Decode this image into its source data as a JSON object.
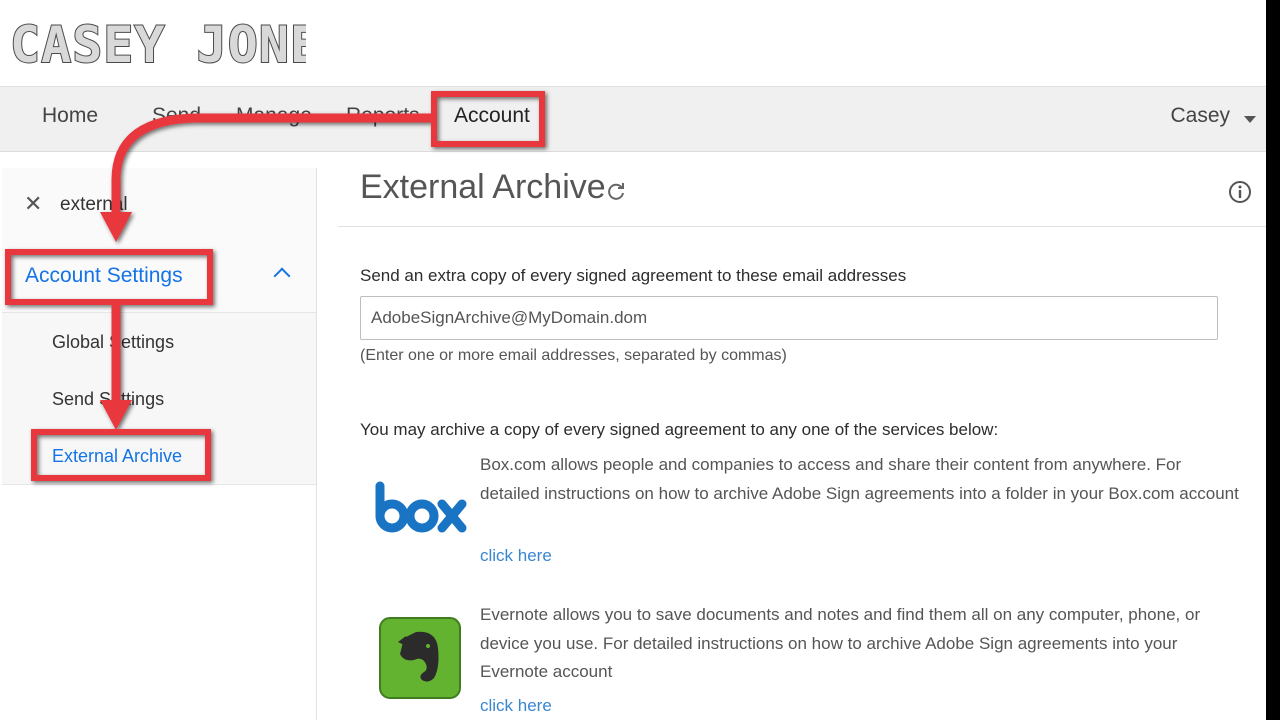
{
  "logo": {
    "text": "CASEY JONES"
  },
  "nav": {
    "items": [
      "Home",
      "Send",
      "Manage",
      "Reports",
      "Account"
    ],
    "user": "Casey"
  },
  "sidebar": {
    "search_value": "external",
    "section": "Account Settings",
    "items": [
      "Global Settings",
      "Send Settings",
      "External Archive"
    ]
  },
  "main": {
    "title": "External Archive",
    "email_label": "Send an extra copy of every signed agreement to these email addresses",
    "email_value": "AdobeSignArchive@MyDomain.dom",
    "email_help": "(Enter one or more email addresses, separated by commas)",
    "archive_label": "You may archive a copy of every signed agreement to any one of the services below:",
    "services": [
      {
        "name": "box",
        "description": "Box.com allows people and companies to access and share their content from anywhere. For detailed instructions on how to archive Adobe Sign agreements into a folder in your Box.com account",
        "link": "click here"
      },
      {
        "name": "evernote",
        "description": "Evernote allows you to save documents and notes and find them all on any computer, phone, or device you use. For detailed instructions on how to archive Adobe Sign agreements into your Evernote account",
        "link": "click here"
      }
    ]
  },
  "colors": {
    "accent": "#1473e6",
    "link": "#3a86d1",
    "annotation": "#e8373d",
    "box_logo": "#1a74c4",
    "evernote_logo": "#63b331"
  }
}
